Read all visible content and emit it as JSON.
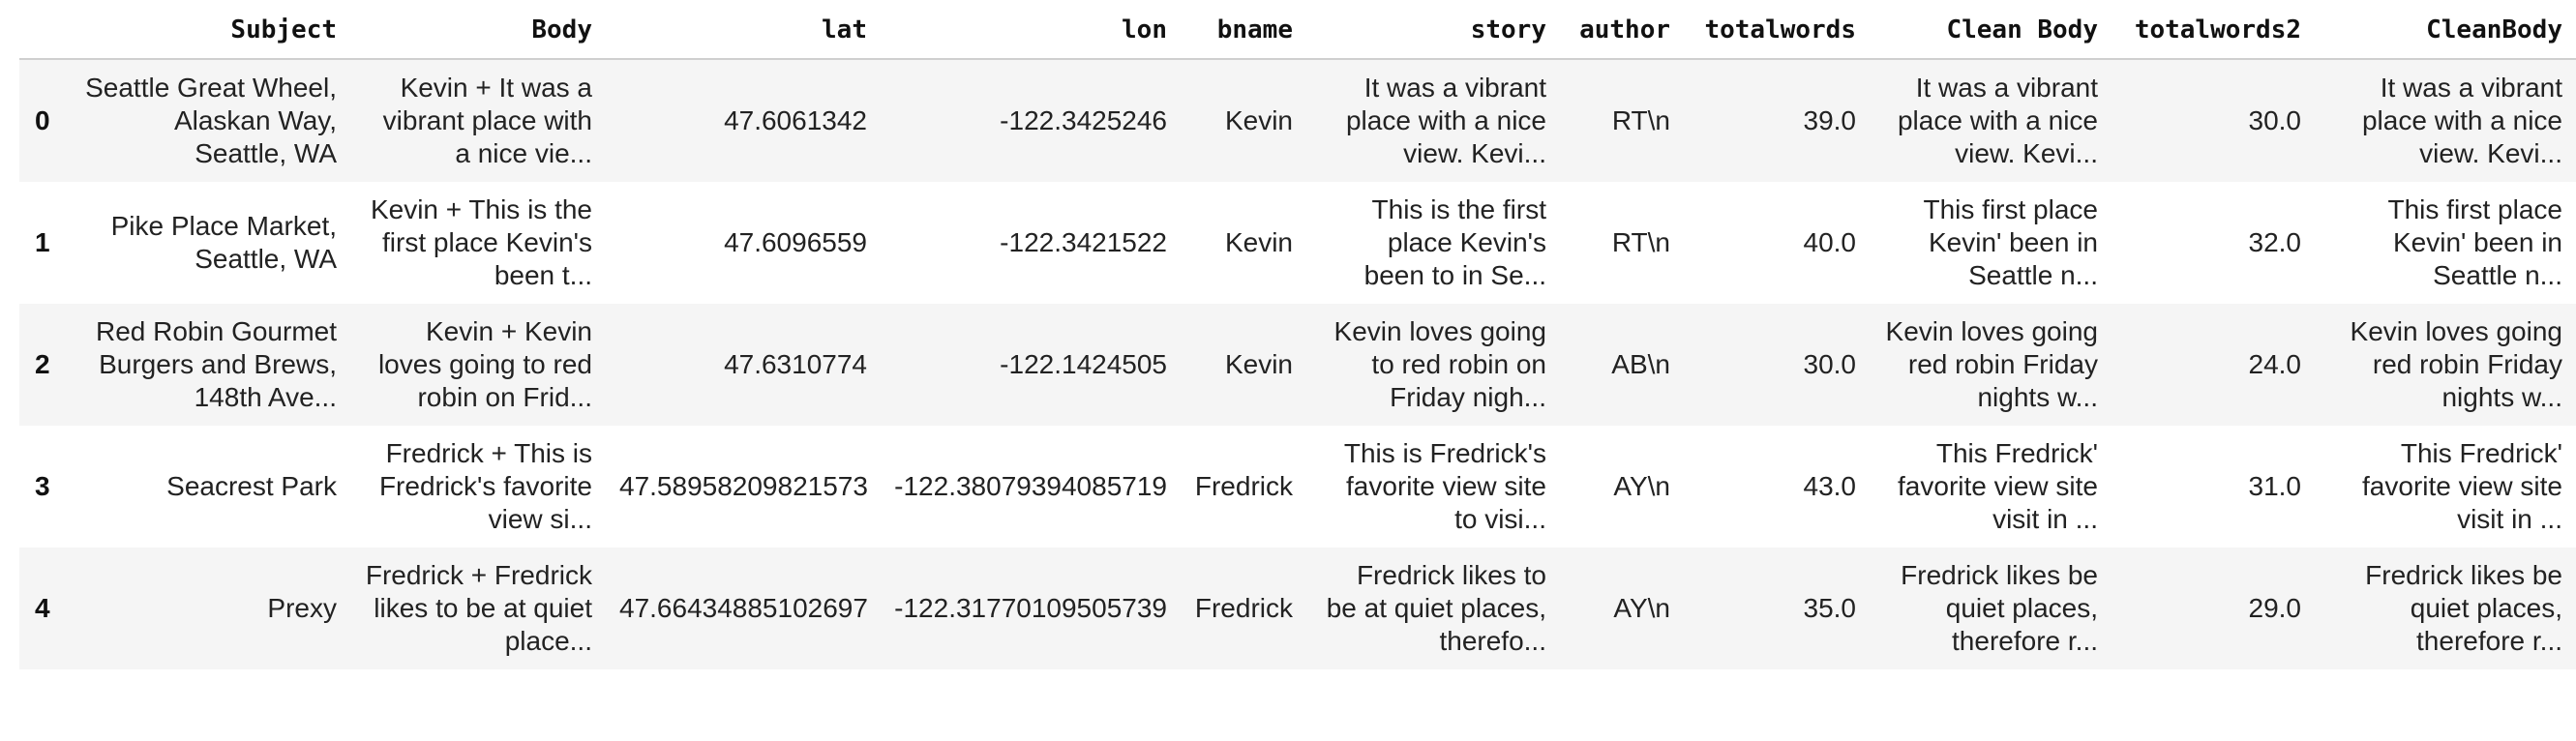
{
  "table": {
    "columns": [
      "",
      "Subject",
      "Body",
      "lat",
      "lon",
      "bname",
      "story",
      "author",
      "totalwords",
      "Clean Body",
      "totalwords2",
      "CleanBody"
    ],
    "rows": [
      {
        "index": "0",
        "cells": [
          "Seattle Great Wheel, Alaskan Way, Seattle, WA",
          "Kevin + It was a vibrant place with a nice vie...",
          "47.6061342",
          "-122.3425246",
          "Kevin",
          "It was a vibrant place with a nice view. Kevi...",
          "RT\\n",
          "39.0",
          "It was a vibrant place with a nice view. Kevi...",
          "30.0",
          "It was a vibrant place with a nice view. Kevi..."
        ]
      },
      {
        "index": "1",
        "cells": [
          "Pike Place Market, Seattle, WA",
          "Kevin + This is the first place Kevin's been t...",
          "47.6096559",
          "-122.3421522",
          "Kevin",
          "This is the first place Kevin's been to in Se...",
          "RT\\n",
          "40.0",
          "This first place Kevin' been in Seattle n...",
          "32.0",
          "This first place Kevin' been in Seattle n..."
        ]
      },
      {
        "index": "2",
        "cells": [
          "Red Robin Gourmet Burgers and Brews, 148th Ave...",
          "Kevin + Kevin loves going to red robin on Frid...",
          "47.6310774",
          "-122.1424505",
          "Kevin",
          "Kevin loves going to red robin on Friday nigh...",
          "AB\\n",
          "30.0",
          "Kevin loves going red robin Friday nights w...",
          "24.0",
          "Kevin loves going red robin Friday nights w..."
        ]
      },
      {
        "index": "3",
        "cells": [
          "Seacrest Park",
          "Fredrick + This is Fredrick's favorite view si...",
          "47.58958209821573",
          "-122.38079394085719",
          "Fredrick",
          "This is Fredrick's favorite view site to visi...",
          "AY\\n",
          "43.0",
          "This Fredrick' favorite view site visit in ...",
          "31.0",
          "This Fredrick' favorite view site visit in ..."
        ]
      },
      {
        "index": "4",
        "cells": [
          "Prexy",
          "Fredrick + Fredrick likes to be at quiet place...",
          "47.66434885102697",
          "-122.31770109505739",
          "Fredrick",
          "Fredrick likes to be at quiet places, therefo...",
          "AY\\n",
          "35.0",
          "Fredrick likes be quiet places, therefore r...",
          "29.0",
          "Fredrick likes be quiet places, therefore r..."
        ]
      }
    ]
  }
}
